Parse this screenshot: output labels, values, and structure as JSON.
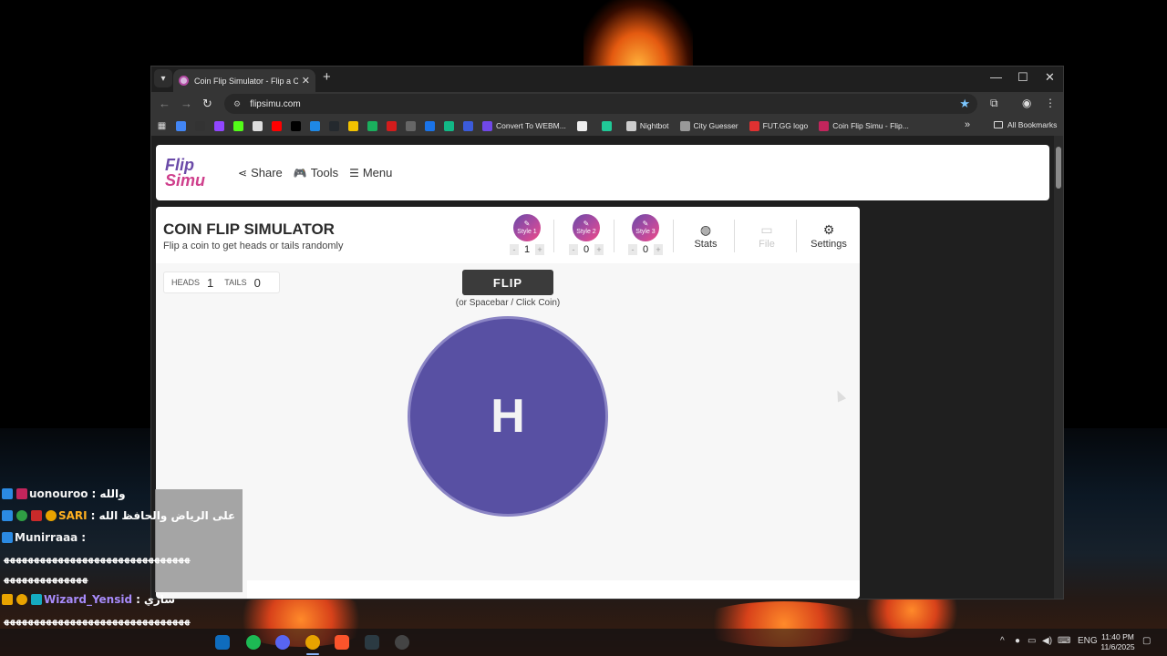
{
  "browser": {
    "tab_title": "Coin Flip Simulator - Flip a Coin",
    "url": "flipsimu.com",
    "bookmarks": [
      {
        "label": "",
        "color": "#4285f4",
        "icon": "google-icon"
      },
      {
        "label": "",
        "color": "#333333",
        "icon": "p-icon"
      },
      {
        "label": "",
        "color": "#9146ff",
        "icon": "twitch-icon"
      },
      {
        "label": "",
        "color": "#53fc18",
        "icon": "kick-icon"
      },
      {
        "label": "",
        "color": "#dddddd",
        "icon": "diamond-icon"
      },
      {
        "label": "",
        "color": "#ff0000",
        "icon": "youtube-icon"
      },
      {
        "label": "",
        "color": "#000000",
        "icon": "x-icon"
      },
      {
        "label": "",
        "color": "#1e88e5",
        "icon": "paypal-icon"
      },
      {
        "label": "",
        "color": "#24292e",
        "icon": "github-icon"
      },
      {
        "label": "",
        "color": "#f2c200",
        "icon": "yellow-icon"
      },
      {
        "label": "",
        "color": "#1aaf5d",
        "icon": "green-icon"
      },
      {
        "label": "",
        "color": "#d31c1c",
        "icon": "red-icon"
      },
      {
        "label": "",
        "color": "#666666",
        "icon": "tv-icon"
      },
      {
        "label": "",
        "color": "#1a73e8",
        "icon": "play-icon"
      },
      {
        "label": "",
        "color": "#12b886",
        "icon": "s-icon"
      },
      {
        "label": "",
        "color": "#3b5bdb",
        "icon": "r-icon"
      }
    ],
    "named_bookmarks": [
      {
        "label": "Convert To WEBM...",
        "color": "#7048e8",
        "icon": "convert-icon"
      },
      {
        "label": "",
        "color": "#eeeeee",
        "icon": "box-icon"
      },
      {
        "label": "",
        "color": "#20c997",
        "icon": "chat-icon"
      },
      {
        "label": "Nightbot",
        "color": "#cccccc",
        "icon": "nightbot-icon"
      },
      {
        "label": "City Guesser",
        "color": "#999999",
        "icon": "globe-icon"
      },
      {
        "label": "FUT.GG logo",
        "color": "#e03131",
        "icon": "futgg-icon"
      },
      {
        "label": "Coin Flip Simu - Flip...",
        "color": "#c2255c",
        "icon": "flipsimu-icon"
      }
    ],
    "all_bookmarks": "All Bookmarks"
  },
  "site": {
    "logo_line1": "Flip",
    "logo_line2": "Simu",
    "nav": {
      "share": "Share",
      "tools": "Tools",
      "menu": "Menu"
    },
    "title": "COIN FLIP SIMULATOR",
    "subtitle": "Flip a coin to get heads or tails randomly",
    "styles": [
      {
        "label": "Style 1",
        "count": "1"
      },
      {
        "label": "Style 2",
        "count": "0"
      },
      {
        "label": "Style 3",
        "count": "0"
      }
    ],
    "tools": {
      "stats": "Stats",
      "file": "File",
      "settings": "Settings"
    },
    "score": {
      "heads_label": "HEADS",
      "heads": "1",
      "tails_label": "TAILS",
      "tails": "0"
    },
    "flip_label": "FLIP",
    "flip_hint": "(or Spacebar / Click Coin)",
    "coin_face": "H",
    "coin_color": "#5850a3"
  },
  "chat": [
    {
      "user": "uonouroo",
      "message": "والله",
      "color": "#f1f1f1"
    },
    {
      "user": "SARI",
      "message": "على الرياض والحافظ الله",
      "color": "#ffb020"
    },
    {
      "user": "Munirraaa",
      "message": "",
      "color": "#f1f1f1"
    },
    {
      "user": "",
      "message": "ﻬﻬﻬﻬﻬﻬﻬﻬﻬﻬﻬﻬﻬﻬﻬﻬﻬﻬﻬﻬﻬﻬﻬﻬﻬﻬﻬﻬﻬﻬﻬ",
      "color": "#ffffff"
    },
    {
      "user": "",
      "message": "ﻬﻬﻬﻬﻬﻬﻬﻬﻬﻬﻬﻬﻬﻬ",
      "color": "#ffffff"
    },
    {
      "user": "Wizard_Yensid",
      "message": "ساري",
      "color": "#a78bfa"
    },
    {
      "user": "",
      "message": "ﻬﻬﻬﻬﻬﻬﻬﻬﻬﻬﻬﻬﻬﻬﻬﻬﻬﻬﻬﻬﻬﻬﻬﻬﻬﻬﻬﻬﻬﻬﻬ",
      "color": "#ffffff"
    }
  ],
  "taskbar": {
    "language": "ENG",
    "time": "11:40 PM",
    "date": "11/6/2025"
  }
}
